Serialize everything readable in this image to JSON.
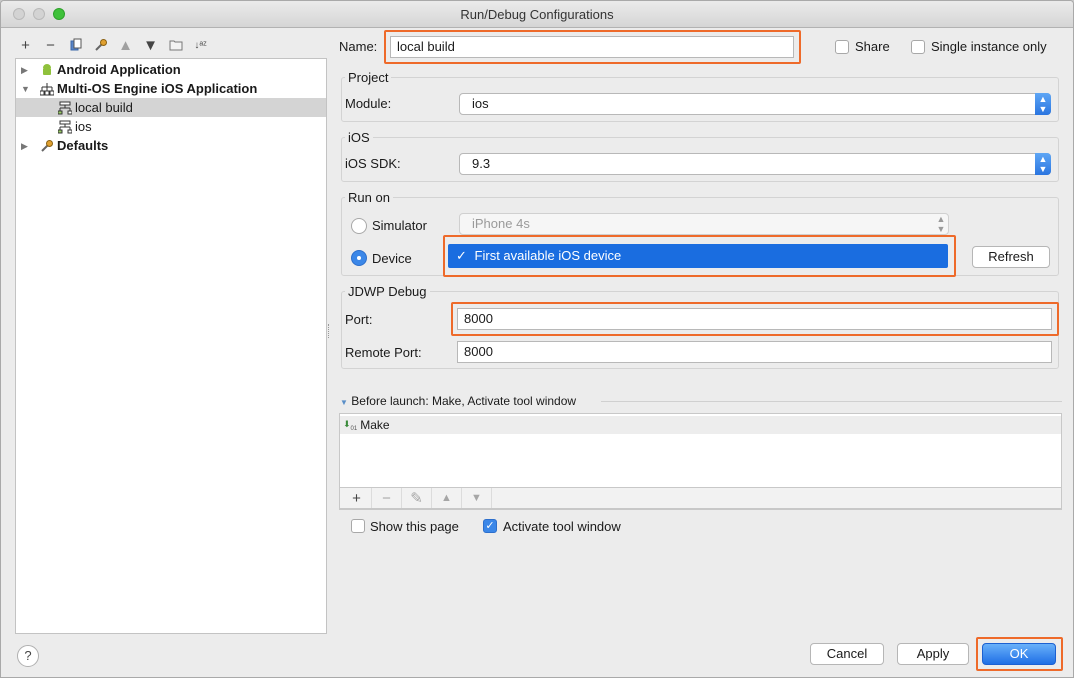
{
  "window": {
    "title": "Run/Debug Configurations"
  },
  "tree": {
    "items": [
      {
        "label": "Android Application",
        "expanded": false,
        "level": 0,
        "bold": true,
        "icon": "android-icon"
      },
      {
        "label": "Multi-OS Engine iOS Application",
        "expanded": true,
        "level": 0,
        "bold": true,
        "icon": "moe-app-icon"
      },
      {
        "label": "local build",
        "level": 1,
        "selected": true,
        "icon": "moe-config-icon"
      },
      {
        "label": "ios",
        "level": 1,
        "icon": "moe-config-icon"
      },
      {
        "label": "Defaults",
        "expanded": false,
        "level": 0,
        "bold": true,
        "icon": "wrench-icon"
      }
    ]
  },
  "form": {
    "name_label": "Name:",
    "name_value": "local build",
    "share_label": "Share",
    "single_instance_label": "Single instance only",
    "project_group": "Project",
    "module_label": "Module:",
    "module_value": "ios",
    "ios_group": "iOS",
    "ios_sdk_label": "iOS SDK:",
    "ios_sdk_value": "9.3",
    "run_on_group": "Run on",
    "simulator_label": "Simulator",
    "simulator_value": "iPhone 4s",
    "device_label": "Device",
    "device_value": "First available iOS device",
    "refresh_label": "Refresh",
    "jdwp_group": "JDWP Debug",
    "port_label": "Port:",
    "port_value": "8000",
    "remote_port_label": "Remote Port:",
    "remote_port_value": "8000",
    "before_launch_label": "Before launch: Make, Activate tool window",
    "before_launch_items": [
      "Make"
    ],
    "show_page_label": "Show this page",
    "activate_tool_label": "Activate tool window"
  },
  "buttons": {
    "cancel": "Cancel",
    "apply": "Apply",
    "ok": "OK",
    "help": "?"
  },
  "colors": {
    "highlight": "#ee6a2a",
    "accent": "#1a6de0"
  }
}
